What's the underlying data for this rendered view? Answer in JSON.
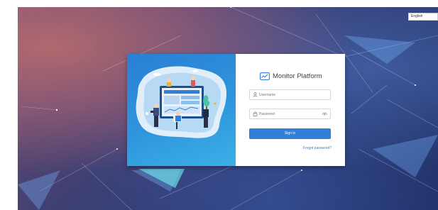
{
  "language": {
    "selected": "English"
  },
  "login": {
    "title": "Monitor Platform",
    "username_placeholder": "Username",
    "password_placeholder": "Password",
    "signin_label": "Sign in",
    "forgot_label": "Forgot password?"
  },
  "icons": {
    "brand": "chart-monitor-icon",
    "username": "user-icon",
    "password": "lock-icon",
    "visibility": "eye-icon"
  },
  "colors": {
    "accent": "#2f80d8",
    "illustration_panel": "#2f95dd",
    "title_text": "#3a3f4a"
  }
}
